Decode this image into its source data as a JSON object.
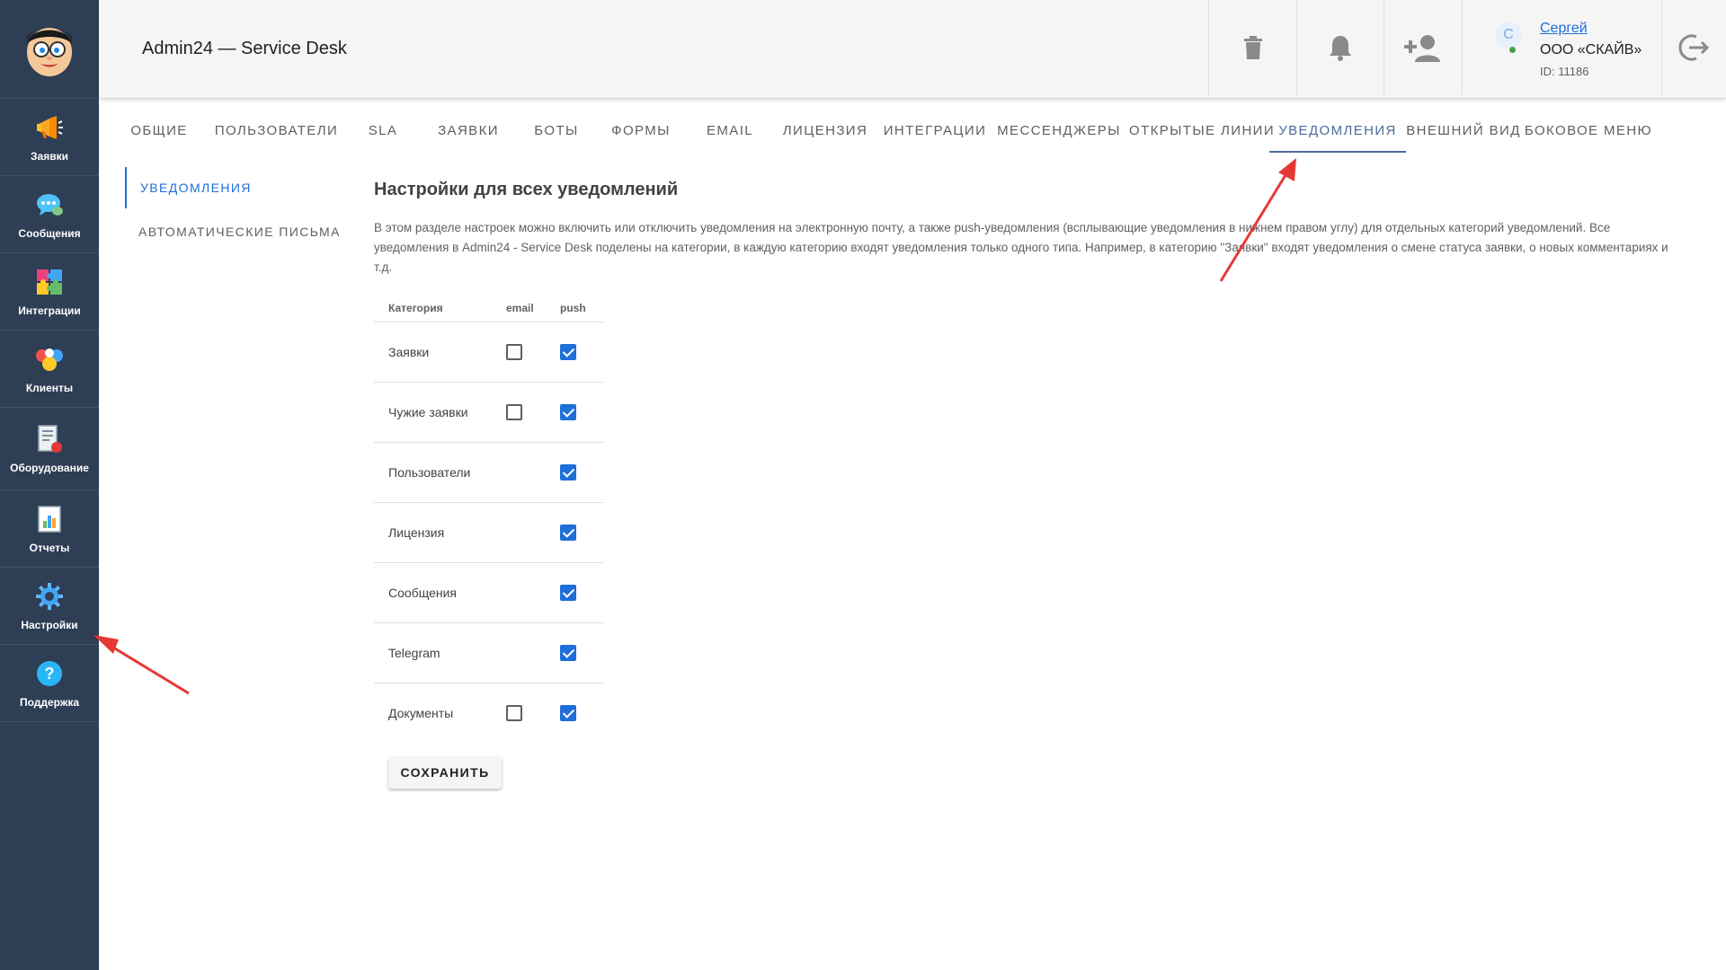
{
  "app": {
    "title": "Admin24 — Service Desk"
  },
  "nav": [
    {
      "id": "tickets",
      "label": "Заявки",
      "icon": "megaphone-icon"
    },
    {
      "id": "messages",
      "label": "Сообщения",
      "icon": "chat-bubble-icon"
    },
    {
      "id": "integrations",
      "label": "Интеграции",
      "icon": "puzzle-icon"
    },
    {
      "id": "clients",
      "label": "Клиенты",
      "icon": "users-icon"
    },
    {
      "id": "equipment",
      "label": "Оборудование",
      "icon": "equipment-icon"
    },
    {
      "id": "reports",
      "label": "Отчеты",
      "icon": "report-icon"
    },
    {
      "id": "settings",
      "label": "Настройки",
      "icon": "gear-icon"
    },
    {
      "id": "support",
      "label": "Поддержка",
      "icon": "help-icon"
    }
  ],
  "header": {
    "actions": [
      "trash-icon",
      "bell-icon",
      "add-user-icon",
      "logout-icon"
    ],
    "user": {
      "avatar_letter": "С",
      "name": "Сергей",
      "org": "ООО «СКАЙВ»",
      "id_text": "ID: 11186"
    }
  },
  "tabs": [
    "Общие",
    "Пользователи",
    "SLA",
    "Заявки",
    "Боты",
    "Формы",
    "Email",
    "Лицензия",
    "Интеграции",
    "Мессенджеры",
    "Открытые линии",
    "Уведомления",
    "Внешний вид",
    "Боковое меню"
  ],
  "active_tab": "Уведомления",
  "subnav": [
    {
      "label": "Уведомления",
      "active": true
    },
    {
      "label": "Автоматические письма",
      "active": false
    }
  ],
  "content": {
    "title": "Настройки для всех уведомлений",
    "description": "В этом разделе настроек можно включить или отключить уведомления на электронную почту, а также push-уведомления (всплывающие уведомления в нижнем правом углу) для отдельных категорий уведомлений. Все уведомления в Admin24 - Service Desk поделены на категории, в каждую категорию входят уведомления только одного типа. Например, в категорию \"Заявки\" входят уведомления о смене статуса заявки, о новых комментариях и т.д.",
    "table": {
      "headers": {
        "category": "Категория",
        "email": "email",
        "push": "push"
      },
      "rows": [
        {
          "category": "Заявки",
          "email": false,
          "push": true
        },
        {
          "category": "Чужие заявки",
          "email": false,
          "push": true
        },
        {
          "category": "Пользователи",
          "email": null,
          "push": true
        },
        {
          "category": "Лицензия",
          "email": null,
          "push": true
        },
        {
          "category": "Сообщения",
          "email": null,
          "push": true
        },
        {
          "category": "Telegram",
          "email": null,
          "push": true
        },
        {
          "category": "Документы",
          "email": false,
          "push": true
        }
      ]
    },
    "save_label": "Сохранить"
  },
  "colors": {
    "sidebar_bg": "#2e3e55",
    "accent_blue": "#1e6fd9",
    "active_tab": "#4a6c9e",
    "annotation_arrow": "#e53935"
  }
}
